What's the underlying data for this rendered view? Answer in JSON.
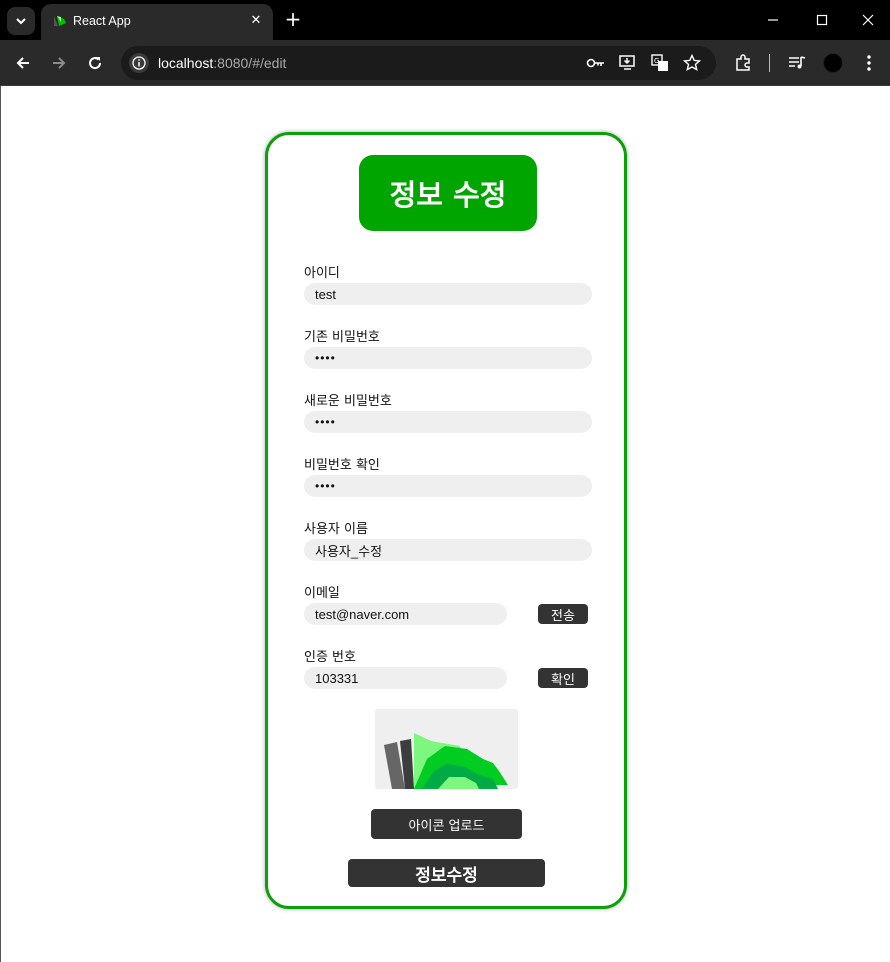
{
  "browser": {
    "tab_title": "React App",
    "url_host": "localhost",
    "url_path": ":8080/#/edit"
  },
  "form": {
    "heading": "정보 수정",
    "fields": [
      {
        "label": "아이디",
        "value": "test"
      },
      {
        "label": "기존 비밀번호",
        "value": "••••"
      },
      {
        "label": "새로운 비밀번호",
        "value": "••••"
      },
      {
        "label": "비밀번호 확인",
        "value": "••••"
      },
      {
        "label": "사용자 이름",
        "value": "사용자_수정"
      },
      {
        "label": "이메일",
        "value": "test@naver.com"
      },
      {
        "label": "인증 번호",
        "value": "103331"
      }
    ],
    "send_button": "전송",
    "confirm_button": "확인",
    "upload_button": "아이콘 업로드",
    "submit_button": "정보수정"
  },
  "colors": {
    "accent_green": "#00a500",
    "card_border": "#0aa10a",
    "button_dark": "#333333",
    "input_bg": "#efefef"
  },
  "icons": [
    "chevron-down-icon",
    "react-favicon-icon",
    "close-icon",
    "plus-icon",
    "minimize-icon",
    "maximize-icon",
    "back-arrow-icon",
    "forward-arrow-icon",
    "reload-icon",
    "info-icon",
    "key-icon",
    "install-icon",
    "translate-icon",
    "star-icon",
    "extensions-icon",
    "media-icon",
    "profile-icon",
    "menu-dots-icon"
  ]
}
